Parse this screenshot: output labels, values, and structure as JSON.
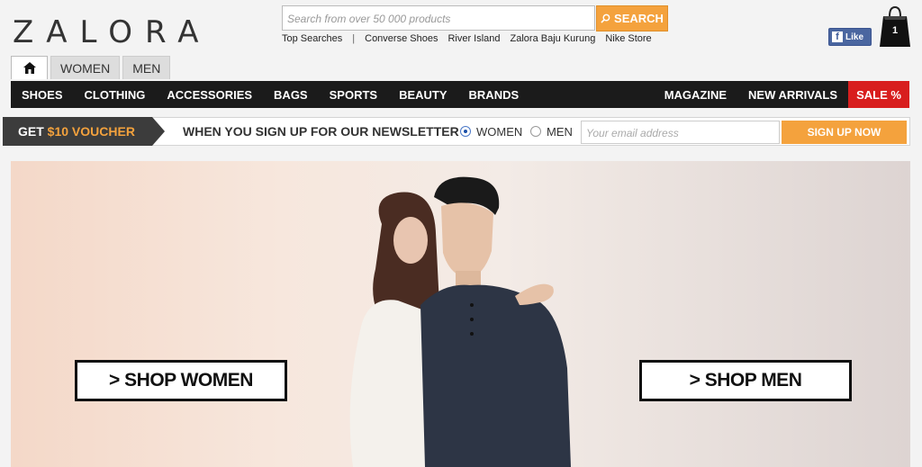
{
  "logo": {
    "text": "ZALORA"
  },
  "search": {
    "placeholder": "Search from over 50 000 products",
    "button_label": "SEARCH",
    "top_searches_label": "Top Searches",
    "separator": "|",
    "top_searches": [
      "Converse Shoes",
      "River Island",
      "Zalora Baju Kurung",
      "Nike Store"
    ]
  },
  "social": {
    "like_label": "Like",
    "fb_glyph": "f"
  },
  "cart": {
    "count": "1"
  },
  "gender_tabs": {
    "home_icon": "home-icon",
    "women": "WOMEN",
    "men": "MEN"
  },
  "nav": {
    "items": [
      "SHOES",
      "CLOTHING",
      "ACCESSORIES",
      "BAGS",
      "SPORTS",
      "BEAUTY",
      "BRANDS"
    ],
    "right_items": [
      "MAGAZINE",
      "NEW ARRIVALS"
    ],
    "sale": "SALE %"
  },
  "newsletter": {
    "voucher_prefix": "GET ",
    "voucher_amount": "$10 VOUCHER",
    "text": "WHEN YOU SIGN UP FOR OUR NEWSLETTER",
    "radio_women": "WOMEN",
    "radio_men": "MEN",
    "selected": "WOMEN",
    "email_placeholder": "Your email address",
    "signup_label": "SIGN UP NOW"
  },
  "hero": {
    "shop_women": "> SHOP WOMEN",
    "shop_men": "> SHOP MEN"
  },
  "colors": {
    "accent": "#f4a23d",
    "nav_bg": "#1b1b1b",
    "sale": "#d81e1e",
    "facebook": "#4a66a0"
  }
}
